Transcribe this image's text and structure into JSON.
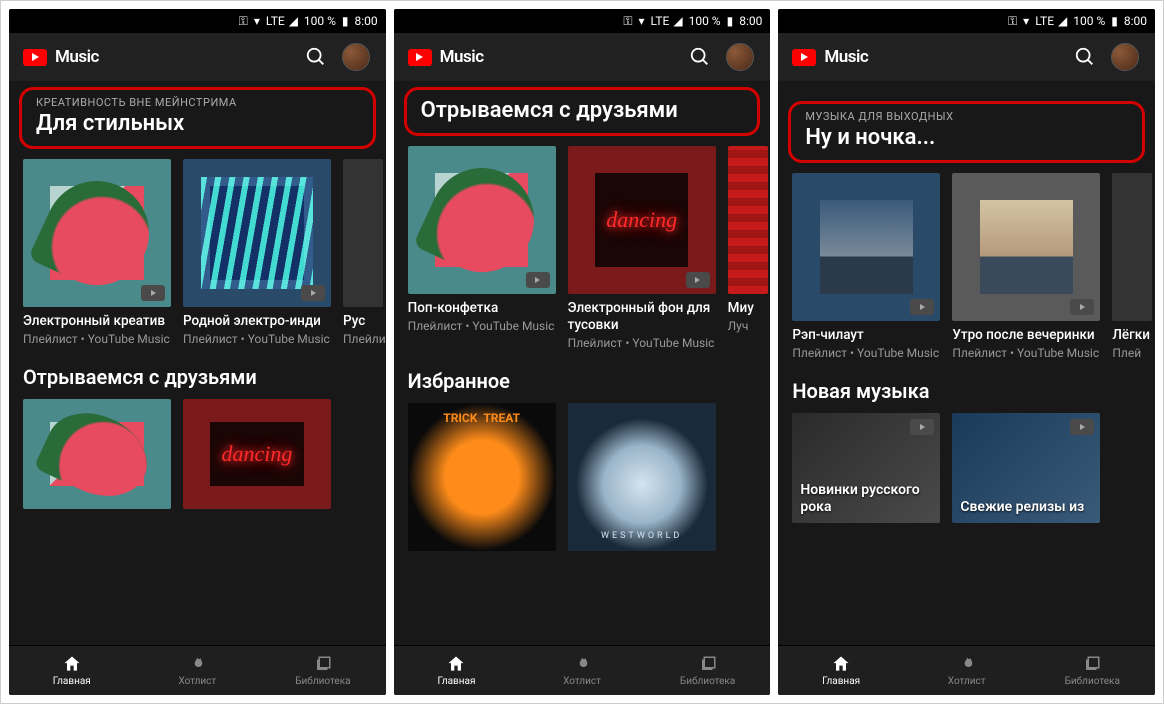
{
  "status": {
    "lte": "LTE",
    "battery": "100 %",
    "time": "8:00"
  },
  "header": {
    "app_name": "Music"
  },
  "nav": {
    "home": "Главная",
    "hotlist": "Хотлист",
    "library": "Библиотека"
  },
  "common": {
    "playlist_sub": "Плейлист •\nYouTube Music",
    "playlist_word": "Плейлист",
    "plei_short": "Плей"
  },
  "screens": [
    {
      "eyebrow": "КРЕАТИВНОСТЬ ВНЕ МЕЙНСТРИМА",
      "title": "Для стильных",
      "cards": [
        {
          "title": "Электронный креатив"
        },
        {
          "title": "Родной электро-инди"
        },
        {
          "title": "Рус"
        }
      ],
      "section2_title": "Отрываемся с друзьями"
    },
    {
      "title": "Отрываемся с друзьями",
      "cards": [
        {
          "title": "Поп-конфетка"
        },
        {
          "title": "Электронный фон для тусовки"
        },
        {
          "title": "Миу",
          "sub2": "Луч"
        }
      ],
      "section2_title": "Избранное"
    },
    {
      "eyebrow": "МУЗЫКА ДЛЯ ВЫХОДНЫХ",
      "title": "Ну и ночка...",
      "cards": [
        {
          "title": "Рэп-чилаут"
        },
        {
          "title": "Утро после вечеринки"
        },
        {
          "title": "Лёгки"
        }
      ],
      "section2_title": "Новая музыка",
      "banners": [
        {
          "title": "Новинки русского рока"
        },
        {
          "title": "Свежие релизы из"
        }
      ]
    }
  ]
}
